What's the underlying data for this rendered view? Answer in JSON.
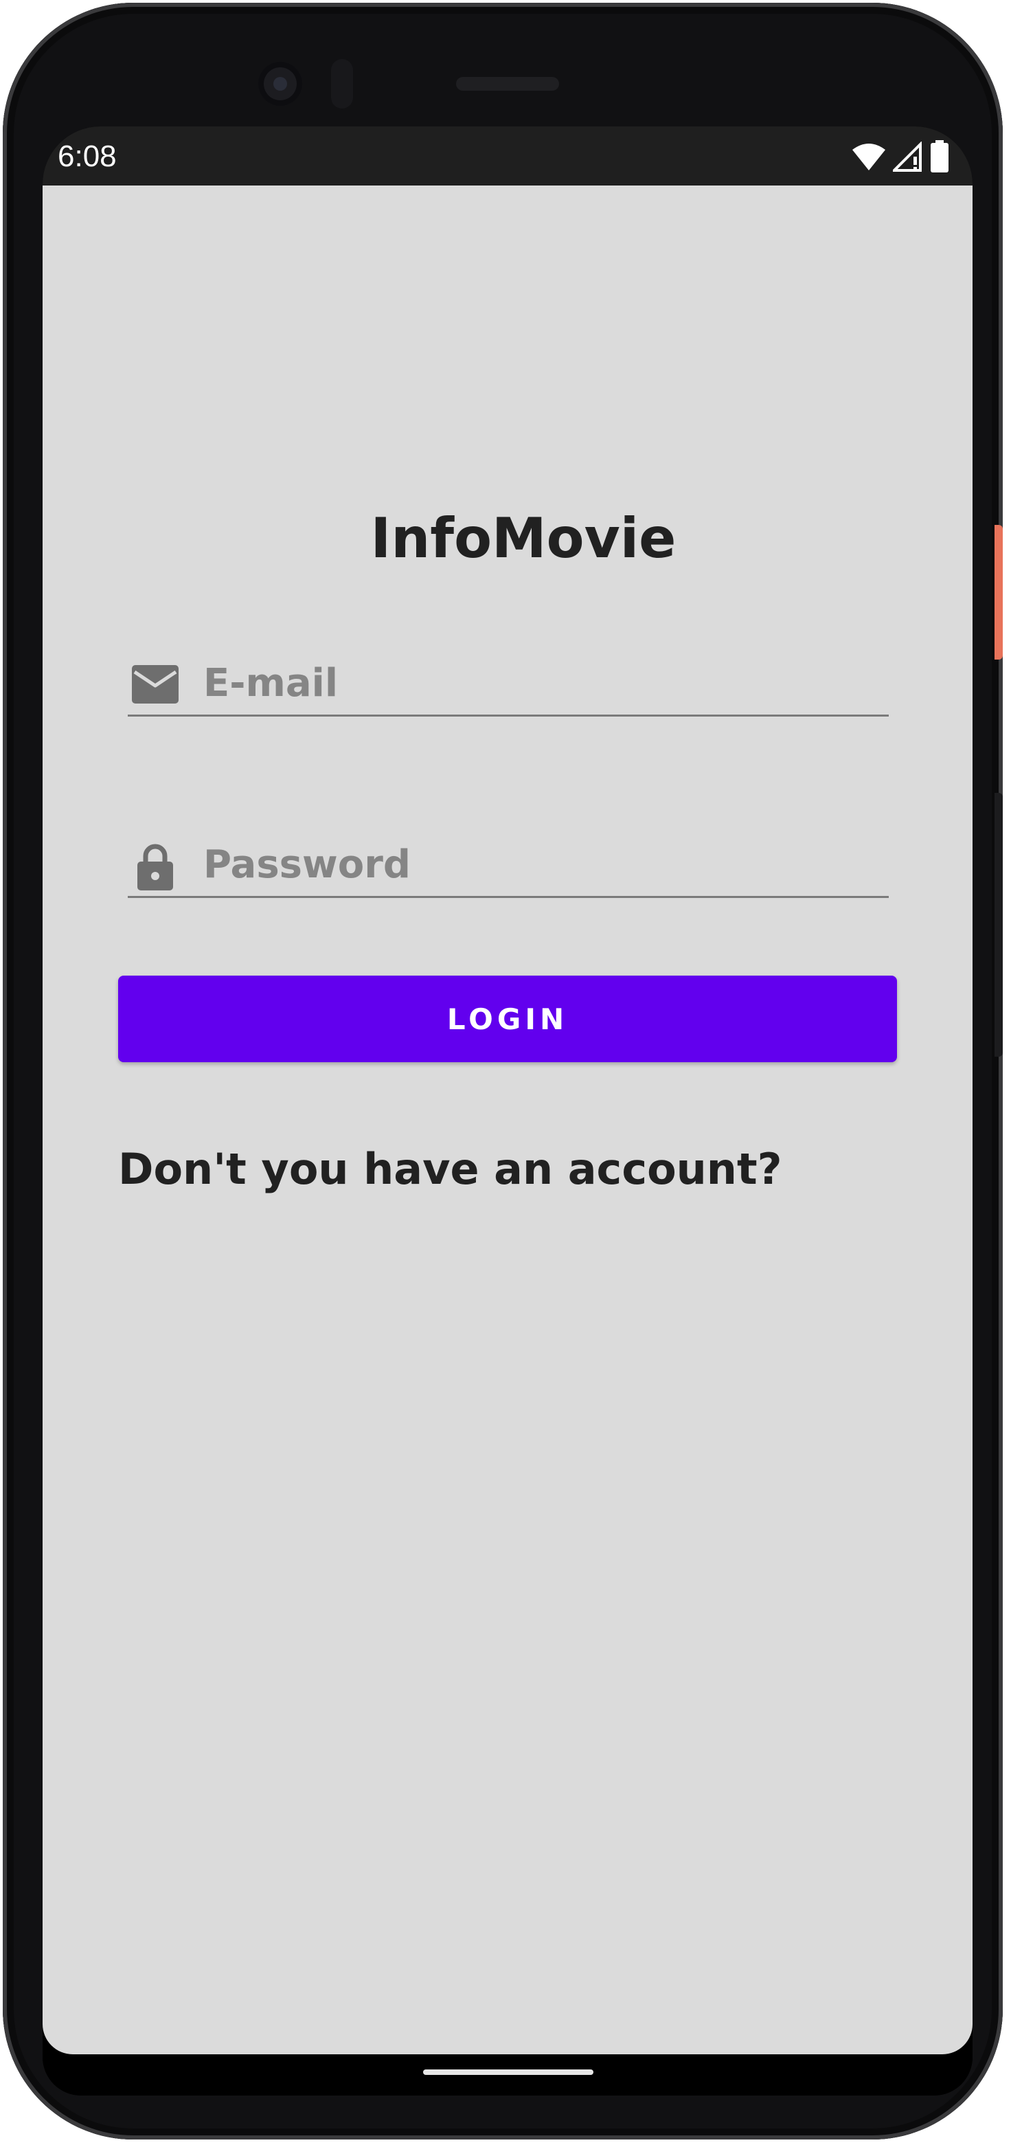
{
  "status_bar": {
    "time": "6:08",
    "icons": [
      "wifi-icon",
      "signal-icon",
      "battery-icon"
    ]
  },
  "app": {
    "title": "InfoMovie",
    "email_field": {
      "placeholder": "E-mail",
      "value": "",
      "icon": "mail-icon"
    },
    "password_field": {
      "placeholder": "Password",
      "value": "",
      "icon": "lock-icon"
    },
    "login_button_label": "LOGIN",
    "register_link": "Don't you have an account?"
  },
  "colors": {
    "background": "#dbdbdb",
    "accent": "#6200ee",
    "text": "#212121",
    "hint": "#858585",
    "icon": "#6e6e6e"
  }
}
